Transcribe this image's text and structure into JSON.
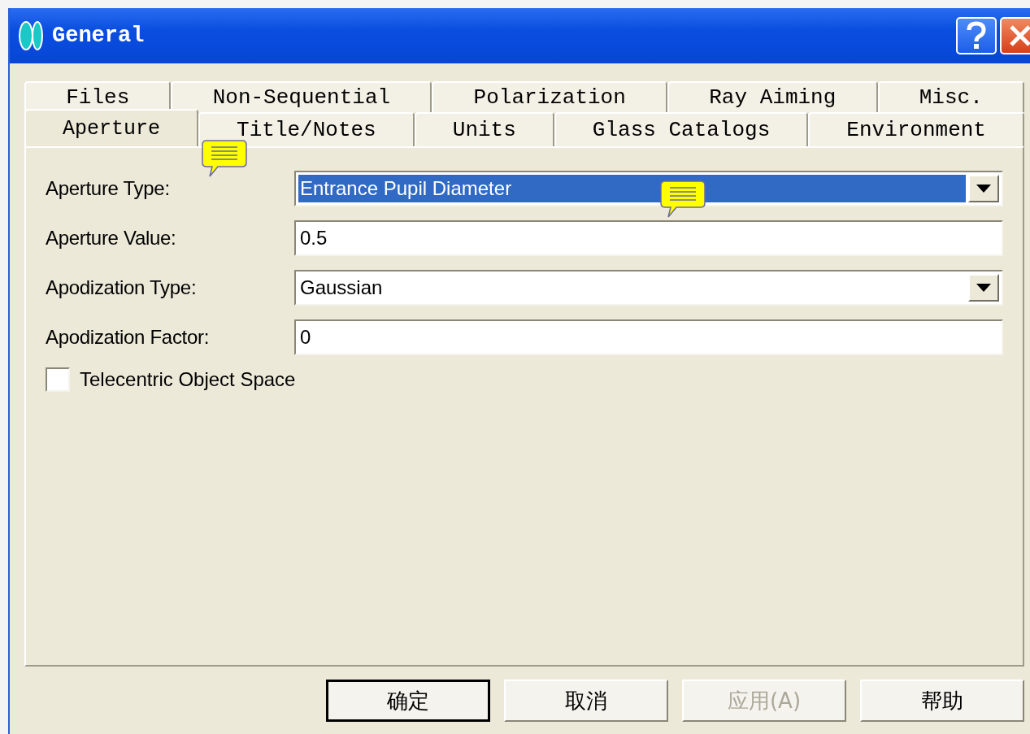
{
  "window": {
    "title": "General"
  },
  "tab_rows": [
    [
      {
        "label": "Files",
        "selected": false
      },
      {
        "label": "Non-Sequential",
        "selected": false
      },
      {
        "label": "Polarization",
        "selected": false
      },
      {
        "label": "Ray Aiming",
        "selected": false
      },
      {
        "label": "Misc.",
        "selected": false
      }
    ],
    [
      {
        "label": "Aperture",
        "selected": true
      },
      {
        "label": "Title/Notes",
        "selected": false
      },
      {
        "label": "Units",
        "selected": false
      },
      {
        "label": "Glass Catalogs",
        "selected": false
      },
      {
        "label": "Environment",
        "selected": false
      }
    ]
  ],
  "fields": [
    {
      "label": "Aperture Type:",
      "kind": "dropdown",
      "value": "Entrance Pupil Diameter",
      "highlighted": true
    },
    {
      "label": "Aperture Value:",
      "kind": "text",
      "value": "0.5",
      "highlighted": false
    },
    {
      "label": "Apodization Type:",
      "kind": "dropdown",
      "value": "Gaussian",
      "highlighted": false
    },
    {
      "label": "Apodization Factor:",
      "kind": "text",
      "value": "0",
      "highlighted": false
    }
  ],
  "checkbox": {
    "label": "Telecentric Object Space",
    "checked": false
  },
  "buttons": [
    {
      "label": "确定",
      "default": true,
      "disabled": false
    },
    {
      "label": "取消",
      "default": false,
      "disabled": false
    },
    {
      "label": "应用(A)",
      "default": false,
      "disabled": true
    },
    {
      "label": "帮助",
      "default": false,
      "disabled": false
    }
  ]
}
